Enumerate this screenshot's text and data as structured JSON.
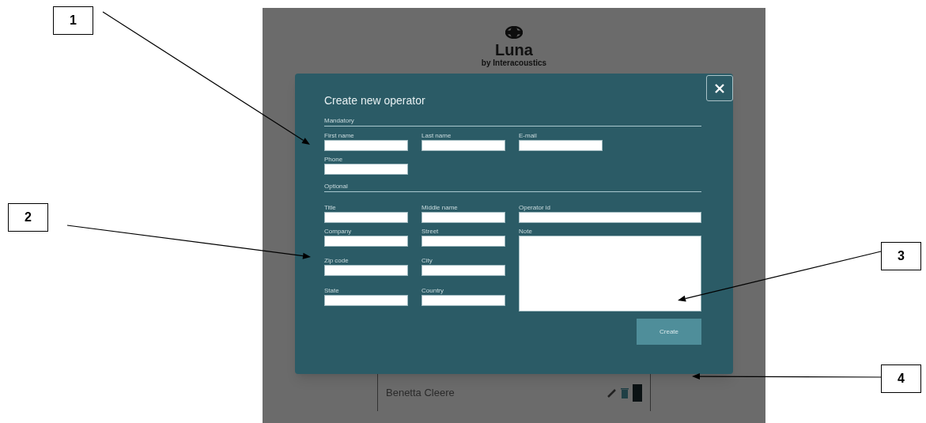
{
  "screen": {
    "logo": {
      "name": "Luna",
      "tagline": "by Interacoustics"
    },
    "dialog": {
      "title": "Create new operator",
      "sections": [
        {
          "label": "Mandatory",
          "fields": [
            {
              "label": "First name",
              "kind": "text"
            },
            {
              "label": "Last name",
              "kind": "text"
            },
            {
              "label": "E-mail",
              "kind": "text"
            },
            {
              "label": "Phone",
              "kind": "text"
            }
          ]
        },
        {
          "label": "Optional",
          "fields": [
            {
              "label": "Title",
              "kind": "text"
            },
            {
              "label": "Middle name",
              "kind": "text"
            },
            {
              "label": "Operator id",
              "kind": "wide"
            },
            {
              "label": "Company",
              "kind": "text"
            },
            {
              "label": "Street",
              "kind": "text"
            },
            {
              "label": "Note",
              "kind": "textarea"
            },
            {
              "label": "Zip code",
              "kind": "text"
            },
            {
              "label": "City",
              "kind": "text"
            },
            {
              "label": "State",
              "kind": "text"
            },
            {
              "label": "Country",
              "kind": "text"
            }
          ]
        }
      ],
      "button": "Create"
    },
    "list_rows": [
      {
        "name": "Benetta Cleere"
      }
    ]
  },
  "callouts": [
    "1",
    "2",
    "3",
    "4"
  ]
}
